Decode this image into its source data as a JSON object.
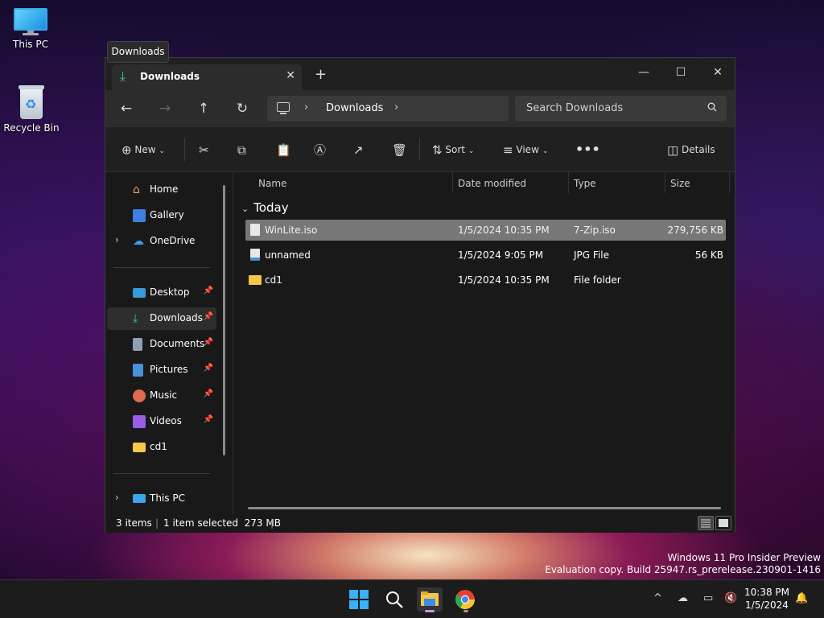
{
  "desktop": {
    "icons": [
      {
        "label": "This PC"
      },
      {
        "label": "Recycle Bin"
      }
    ]
  },
  "tooltip": "Downloads",
  "window": {
    "tab_title": "Downloads",
    "breadcrumb": "Downloads",
    "search_placeholder": "Search Downloads",
    "commands": {
      "new": "New",
      "sort": "Sort",
      "view": "View",
      "details": "Details"
    },
    "sidebar": {
      "home": "Home",
      "gallery": "Gallery",
      "onedrive": "OneDrive",
      "desktop": "Desktop",
      "downloads": "Downloads",
      "documents": "Documents",
      "pictures": "Pictures",
      "music": "Music",
      "videos": "Videos",
      "cd1": "cd1",
      "thispc": "This PC"
    },
    "columns": {
      "name": "Name",
      "date": "Date modified",
      "type": "Type",
      "size": "Size"
    },
    "group": "Today",
    "files": [
      {
        "name": "WinLite.iso",
        "date": "1/5/2024 10:35 PM",
        "type": "7-Zip.iso",
        "size": "279,756 KB"
      },
      {
        "name": "unnamed",
        "date": "1/5/2024 9:05 PM",
        "type": "JPG File",
        "size": "56 KB"
      },
      {
        "name": "cd1",
        "date": "1/5/2024 10:35 PM",
        "type": "File folder",
        "size": ""
      }
    ],
    "status": {
      "count": "3 items",
      "selection": "1 item selected  273 MB"
    }
  },
  "watermark": {
    "line1": "Windows 11 Pro Insider Preview",
    "line2": "Evaluation copy. Build 25947.rs_prerelease.230901-1416"
  },
  "clock": {
    "time": "10:38 PM",
    "date": "1/5/2024"
  },
  "colors": {
    "accent": "#3fc7a0",
    "selected_row": "#777777",
    "folder": "#f6c648"
  }
}
